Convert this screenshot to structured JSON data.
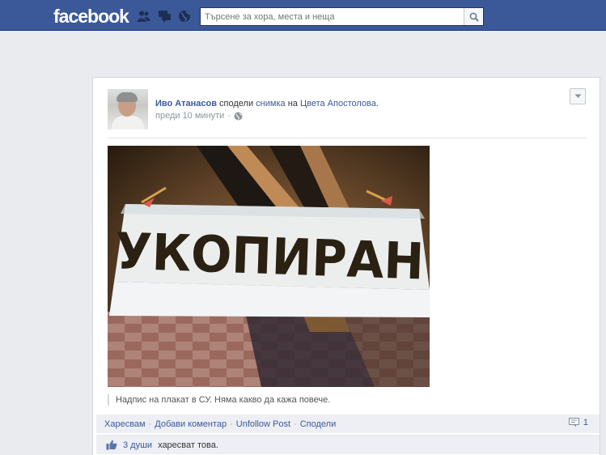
{
  "topbar": {
    "logo": "facebook",
    "search": {
      "placeholder": "Търсене за хора, места и неща",
      "value": ""
    },
    "icons": [
      "friend-requests-icon",
      "messages-icon",
      "notifications-globe-icon",
      "search-icon"
    ]
  },
  "post": {
    "author": "Иво Атанасов",
    "verb": "сподели",
    "object": "снимка",
    "preposition": "на",
    "owner": "Цвета Апостолова",
    "period": ".",
    "time": "преди 10 минути",
    "time_separator": "·",
    "audience_icon": "globe-icon",
    "photo": {
      "description_icon": "banner-photo",
      "banner_text": "УКОПИРАН"
    },
    "caption": "Надпис на плакат в СУ. Няма какво да кажа повече.",
    "actions": {
      "like": "Харесвам",
      "comment": "Добави коментар",
      "unfollow": "Unfollow Post",
      "share": "Сподели",
      "separator": "·"
    },
    "comments_count": "1",
    "likes_text_count": "3 души",
    "likes_text_rest": "харесват това."
  },
  "colors": {
    "brand": "#3b5998",
    "background": "#e9ebee",
    "action_bar": "#edeff4"
  }
}
